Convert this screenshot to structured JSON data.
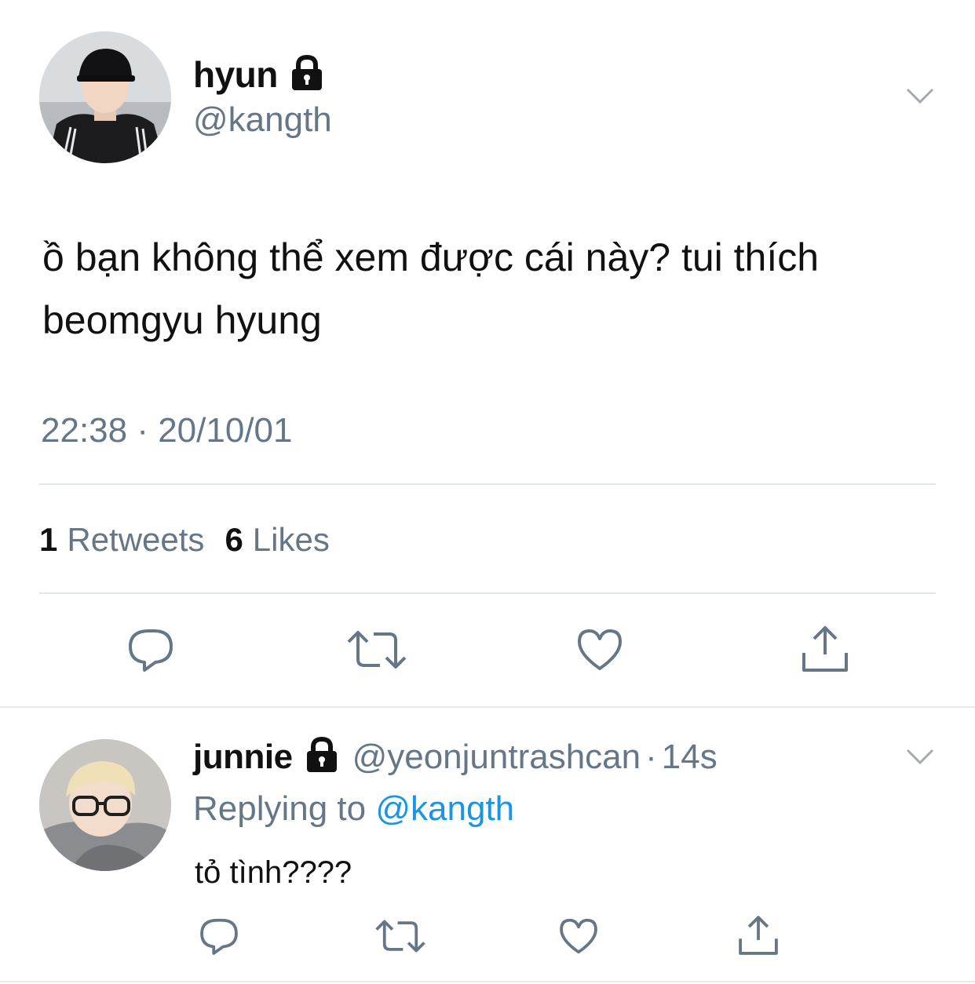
{
  "tweet": {
    "display_name": "hyun",
    "handle": "@kangth",
    "text_line1": "ồ bạn không thể xem được cái này? tui thích",
    "text_line2": "beomgyu hyung",
    "timestamp": "22:38 · 20/10/01",
    "retweets_count": "1",
    "retweets_label": "Retweets",
    "likes_count": "6",
    "likes_label": "Likes",
    "icons": {
      "locked": "lock-icon",
      "menu": "chevron-down-icon",
      "reply": "reply-icon",
      "retweet": "retweet-icon",
      "like": "heart-icon",
      "share": "share-icon"
    }
  },
  "reply": {
    "display_name": "junnie",
    "handle": "@yeonjuntrashcan",
    "separator": "·",
    "time": "14s",
    "replying_to_label": "Replying to",
    "replying_to_handle": "@kangth",
    "text": "tỏ tình????"
  },
  "colors": {
    "secondary_text": "#657786",
    "link": "#1b95e0",
    "divider": "#e1e8ed"
  }
}
